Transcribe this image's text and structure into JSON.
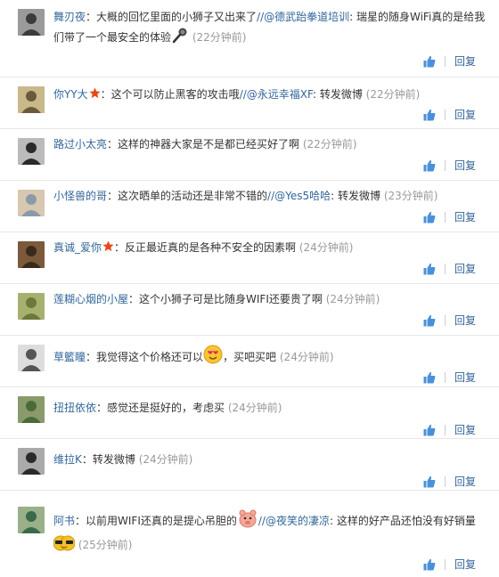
{
  "icons": {
    "like": "thumbs-up-icon",
    "star": "star-badge-icon",
    "avatar": "user-avatar"
  },
  "colors": {
    "link": "#336699",
    "time": "#999999",
    "text": "#333333",
    "divider": "#e6e6e6",
    "star": "#e64a19",
    "like": "#4a90d9"
  },
  "comments": [
    {
      "name": "舞刃夜",
      "text": "：大概的回忆里面的小狮子又出来了",
      "mention": "//@德武跆拳道培训",
      "text2": ": 瑞星的随身WiFi真的是给我们带了一个最安全的体验",
      "emoji": "microphone-emoji",
      "time": "(22分钟前)",
      "reply": "回复"
    },
    {
      "name": "你YY大",
      "badge": "star",
      "text": "：这个可以防止黑客的攻击哦",
      "mention": "//@永远幸福XF",
      "text2": ": 转发微博",
      "time": "(22分钟前)",
      "reply": "回复"
    },
    {
      "name": "路过小太亮",
      "text": "：这样的神器大家是不是都已经买好了啊",
      "time": "(22分钟前)",
      "reply": "回复"
    },
    {
      "name": "小怪兽的哥",
      "text": "：这次晒单的活动还是非常不错的",
      "mention": "//@Yes5哈哈",
      "text2": ": 转发微博",
      "time": "(23分钟前)",
      "reply": "回复"
    },
    {
      "name": "真诚_爱你",
      "badge": "star",
      "text": "：反正最近真的是各种不安全的因素啊",
      "time": "(24分钟前)",
      "reply": "回复"
    },
    {
      "name": "莲糊心烟的小屋",
      "text": "：这个小狮子可是比随身WIFI还要贵了啊",
      "time": "(24分钟前)",
      "reply": "回复"
    },
    {
      "name": "草籃瞳",
      "text": "：我觉得这个价格还可以",
      "emoji": "heart-eyes-emoji",
      "text2": "，买吧买吧",
      "time": "(24分钟前)",
      "reply": "回复"
    },
    {
      "name": "扭扭依依",
      "text": "：感觉还是挺好的，考虑买",
      "time": "(24分钟前)",
      "reply": "回复"
    },
    {
      "name": "维拉K",
      "text": "：转发微博",
      "time": "(24分钟前)",
      "reply": "回复"
    },
    {
      "name": "阿书",
      "text": "：以前用WIFI还真的是提心吊胆的",
      "emoji": "nervous-pig-emoji",
      "mention": "//@夜笑的凄凉",
      "text2": ": 这样的好产品还怕没有好销量",
      "emoji2": "sunglasses-emoji",
      "time": "(25分钟前)",
      "reply": "回复"
    }
  ]
}
